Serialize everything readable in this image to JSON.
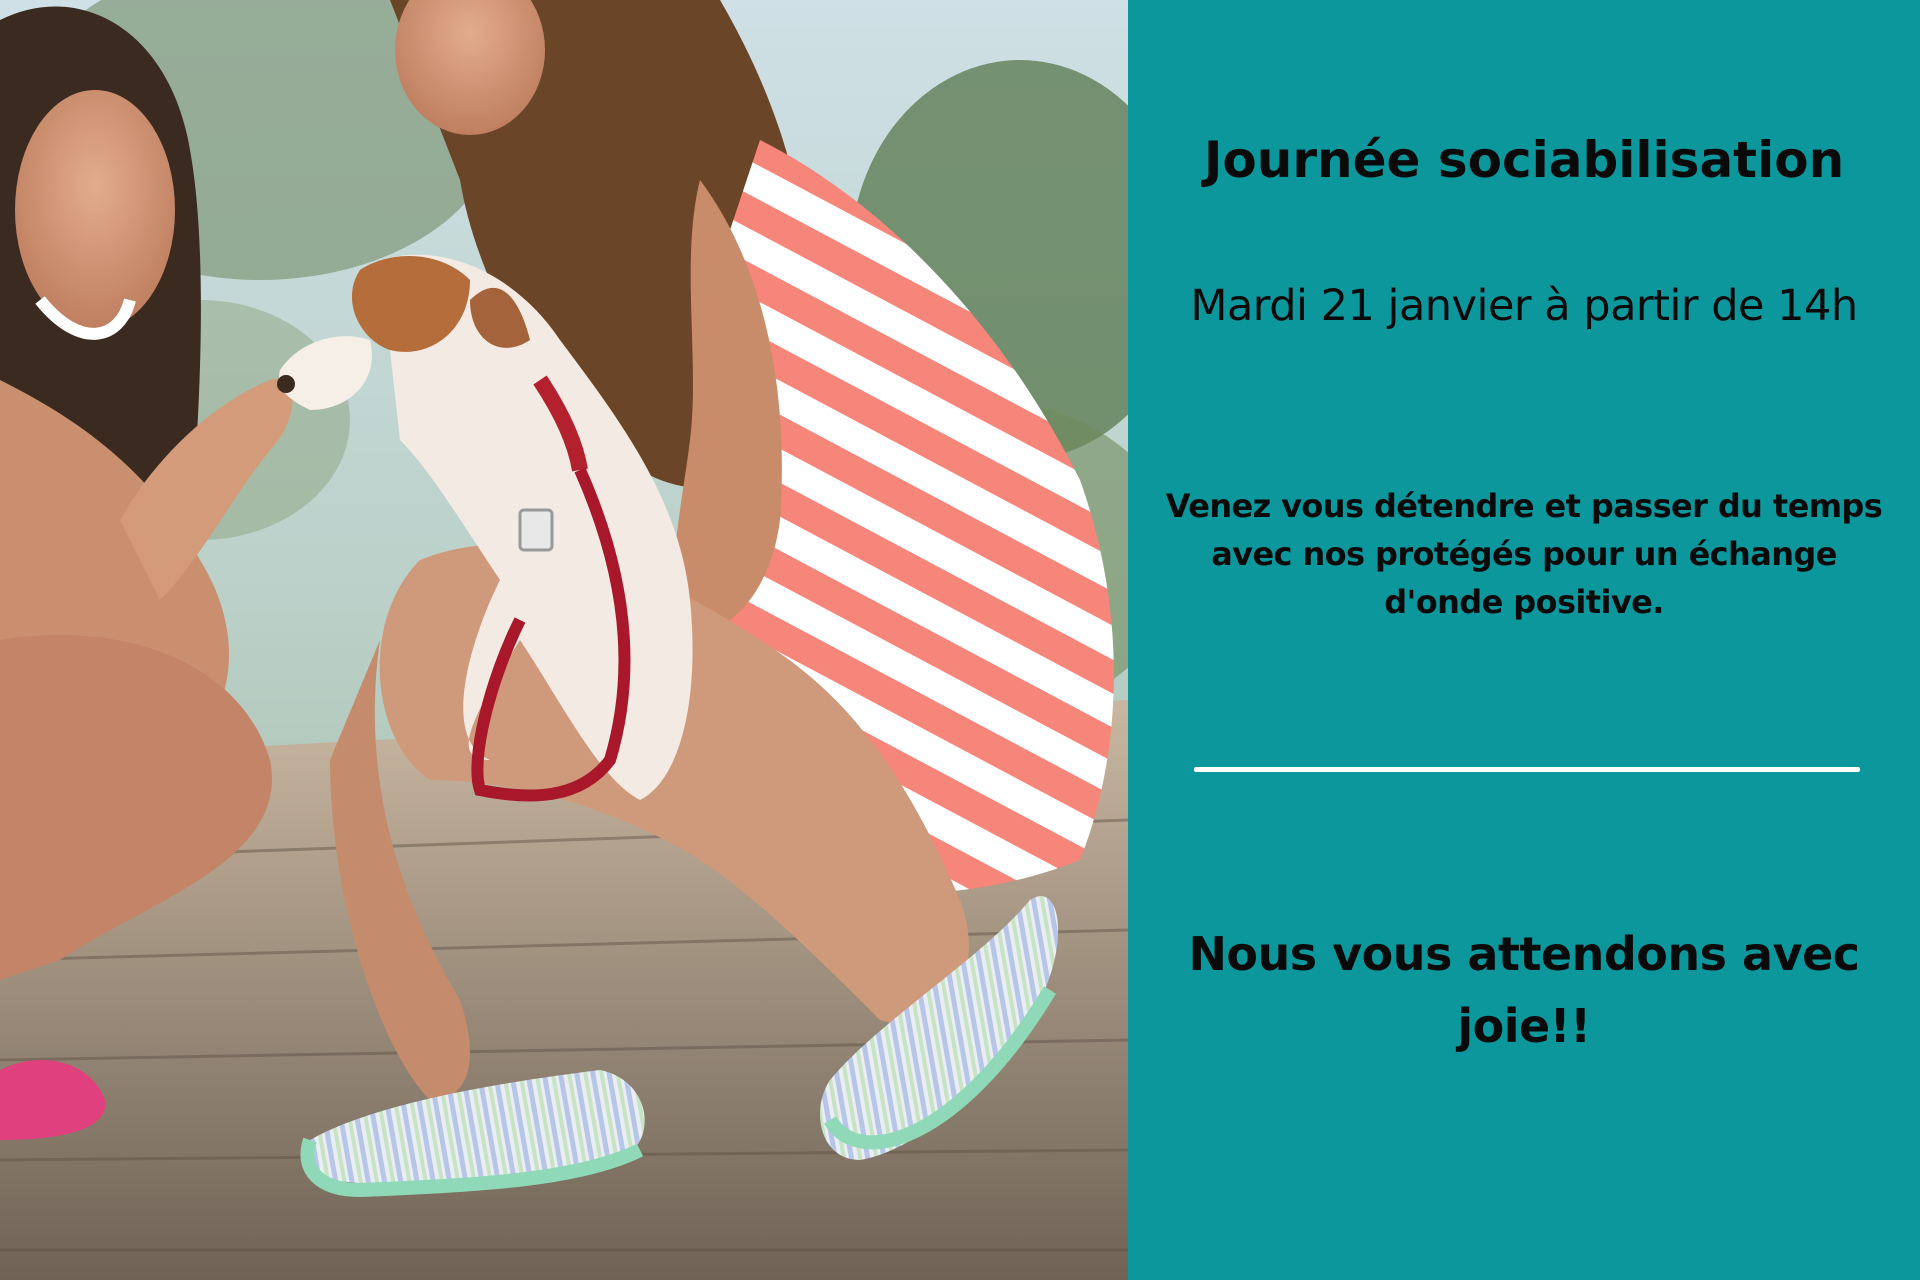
{
  "title": "Journée sociabilisation",
  "date": "Mardi 21 janvier à partir de 14h",
  "description": {
    "line1": "Venez vous détendre et passer du temps",
    "line2": "avec nos protégés pour un échange",
    "line3": "d'onde positive."
  },
  "closing": {
    "line1": "Nous vous attendons avec",
    "line2": "joie!!"
  },
  "colors": {
    "panel_background": "#0b979c",
    "text": "#0a0a0a",
    "divider": "#ffffff"
  }
}
